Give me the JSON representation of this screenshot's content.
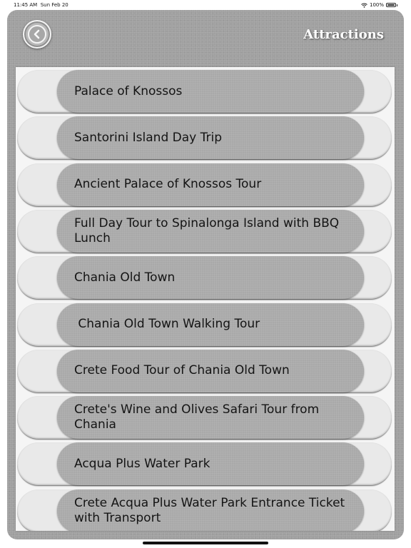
{
  "status_bar": {
    "time": "11:45 AM",
    "date": "Sun Feb 20",
    "battery": "100%"
  },
  "header": {
    "title": "Attractions",
    "back_icon": "chevron-left-icon"
  },
  "attractions": [
    {
      "label": "Palace of Knossos"
    },
    {
      "label": "Santorini Island Day Trip"
    },
    {
      "label": "Ancient Palace of Knossos Tour"
    },
    {
      "label": "Full Day Tour to Spinalonga Island with BBQ Lunch"
    },
    {
      "label": "Chania Old Town"
    },
    {
      "label": " Chania Old Town Walking Tour"
    },
    {
      "label": "Crete Food Tour of Chania Old Town"
    },
    {
      "label": "Crete's Wine and Olives Safari Tour from Chania"
    },
    {
      "label": "Acqua Plus Water Park"
    },
    {
      "label": "Crete Acqua Plus Water Park Entrance Ticket with Transport"
    }
  ]
}
